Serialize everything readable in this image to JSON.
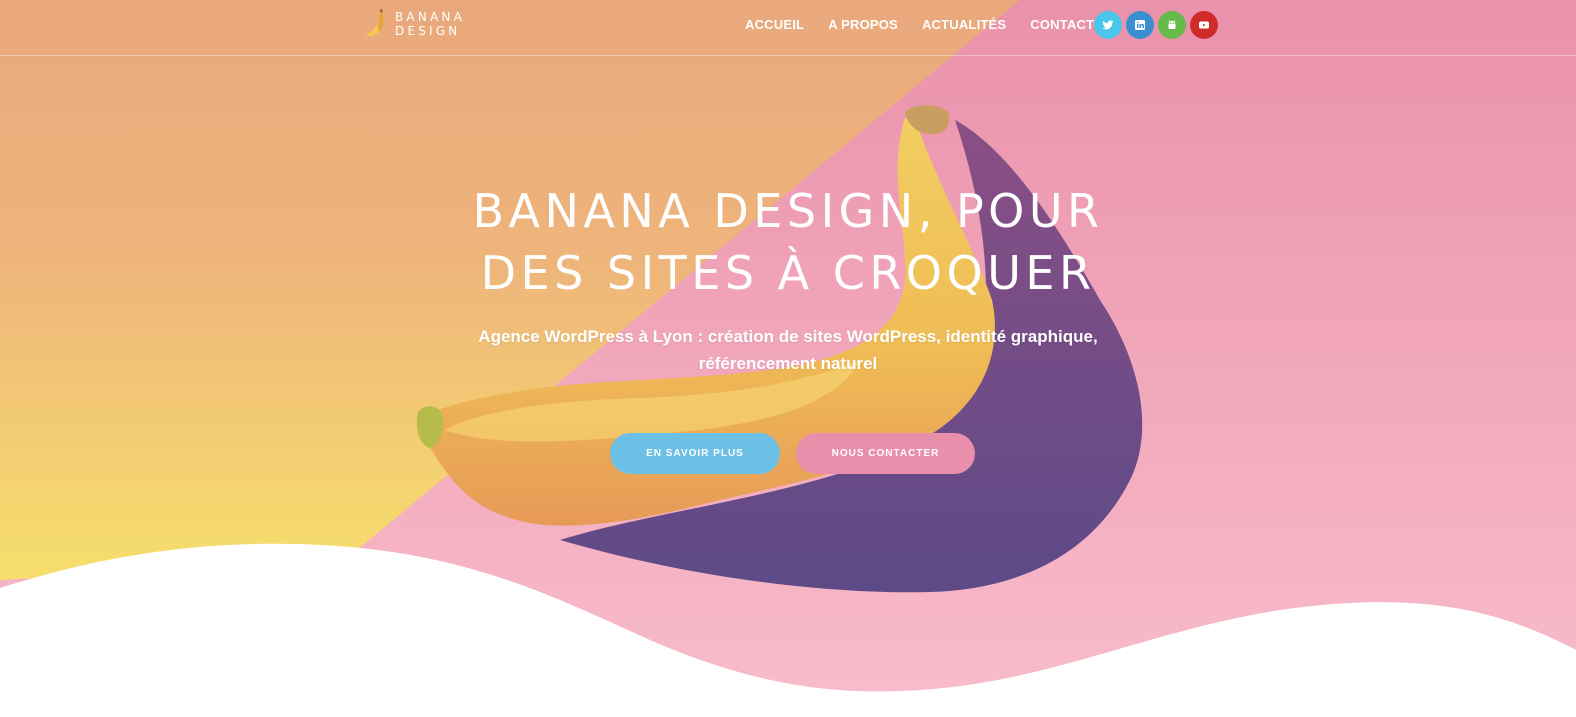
{
  "brand": {
    "line1": "BANANA",
    "line2": "DESIGN"
  },
  "nav": [
    {
      "label": "ACCUEIL"
    },
    {
      "label": "A PROPOS"
    },
    {
      "label": "ACTUALITÉS"
    },
    {
      "label": "CONTACT"
    }
  ],
  "social": [
    {
      "icon": "twitter-icon",
      "color": "#4ac6ea"
    },
    {
      "icon": "linkedin-icon",
      "color": "#3a8fd0"
    },
    {
      "icon": "android-icon",
      "color": "#64bb4a"
    },
    {
      "icon": "youtube-icon",
      "color": "#d02b2b"
    }
  ],
  "hero": {
    "title_line1": "BANANA DESIGN, POUR",
    "title_line2": "DES SITES À CROQUER",
    "subtitle_line1": "Agence WordPress à Lyon : création de sites WordPress, identité graphique,",
    "subtitle_line2": "référencement naturel",
    "primary_button": "EN SAVOIR PLUS",
    "secondary_button": "NOUS CONTACTER"
  },
  "colors": {
    "orange": "#e9a97a",
    "yellow": "#f6e070",
    "pink": "#eb93ad",
    "pink_light": "#f8bccb",
    "shadow_purple": "#5d4a87",
    "button_blue": "#6cc0e5",
    "button_pink": "#e98fac"
  }
}
